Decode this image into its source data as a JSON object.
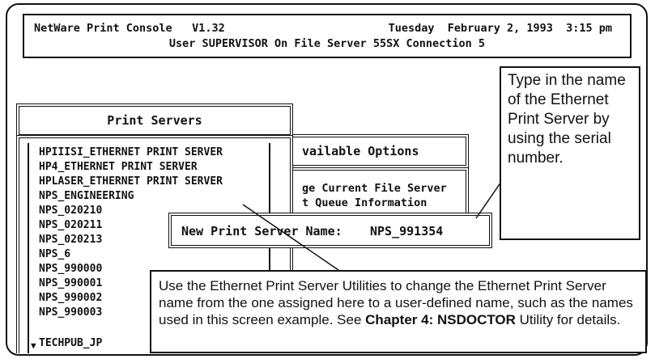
{
  "header": {
    "app_title": "NetWare Print Console   V1.32",
    "date_time": "Tuesday  February 2, 1993  3:15 pm",
    "user_line": "User SUPERVISOR On File Server 55SX Connection 5"
  },
  "available_options": {
    "title": "vailable Options",
    "items": [
      "ge Current File Server",
      "t Queue Information"
    ]
  },
  "print_servers": {
    "title": "Print Servers",
    "items": [
      "HPIIISI_ETHERNET PRINT SERVER",
      "HP4_ETHERNET PRINT SERVER",
      "HPLASER_ETHERNET PRINT SERVER",
      "NPS_ENGINEERING",
      "NPS_020210",
      "NPS_020211",
      "NPS_020213",
      "NPS_6",
      "NPS_990000",
      "NPS_990001",
      "NPS_990002",
      "NPS_990003",
      "TECHPUB_JP"
    ],
    "scroll_icon": "down-triangle-icon"
  },
  "new_name_dialog": {
    "label": "New Print Server Name:",
    "value": "NPS_991354"
  },
  "callouts": {
    "right": "Type in the name of the Ethernet Print Server by using the serial number.",
    "bottom_pre": "Use the Ethernet Print Server Utilities to change the Ethernet Print Server name from the one assigned here to a user-defined name, such as the names used in this screen example. See ",
    "bottom_bold": "Chapter 4: NSDOCTOR",
    "bottom_post": " Utility for details."
  }
}
